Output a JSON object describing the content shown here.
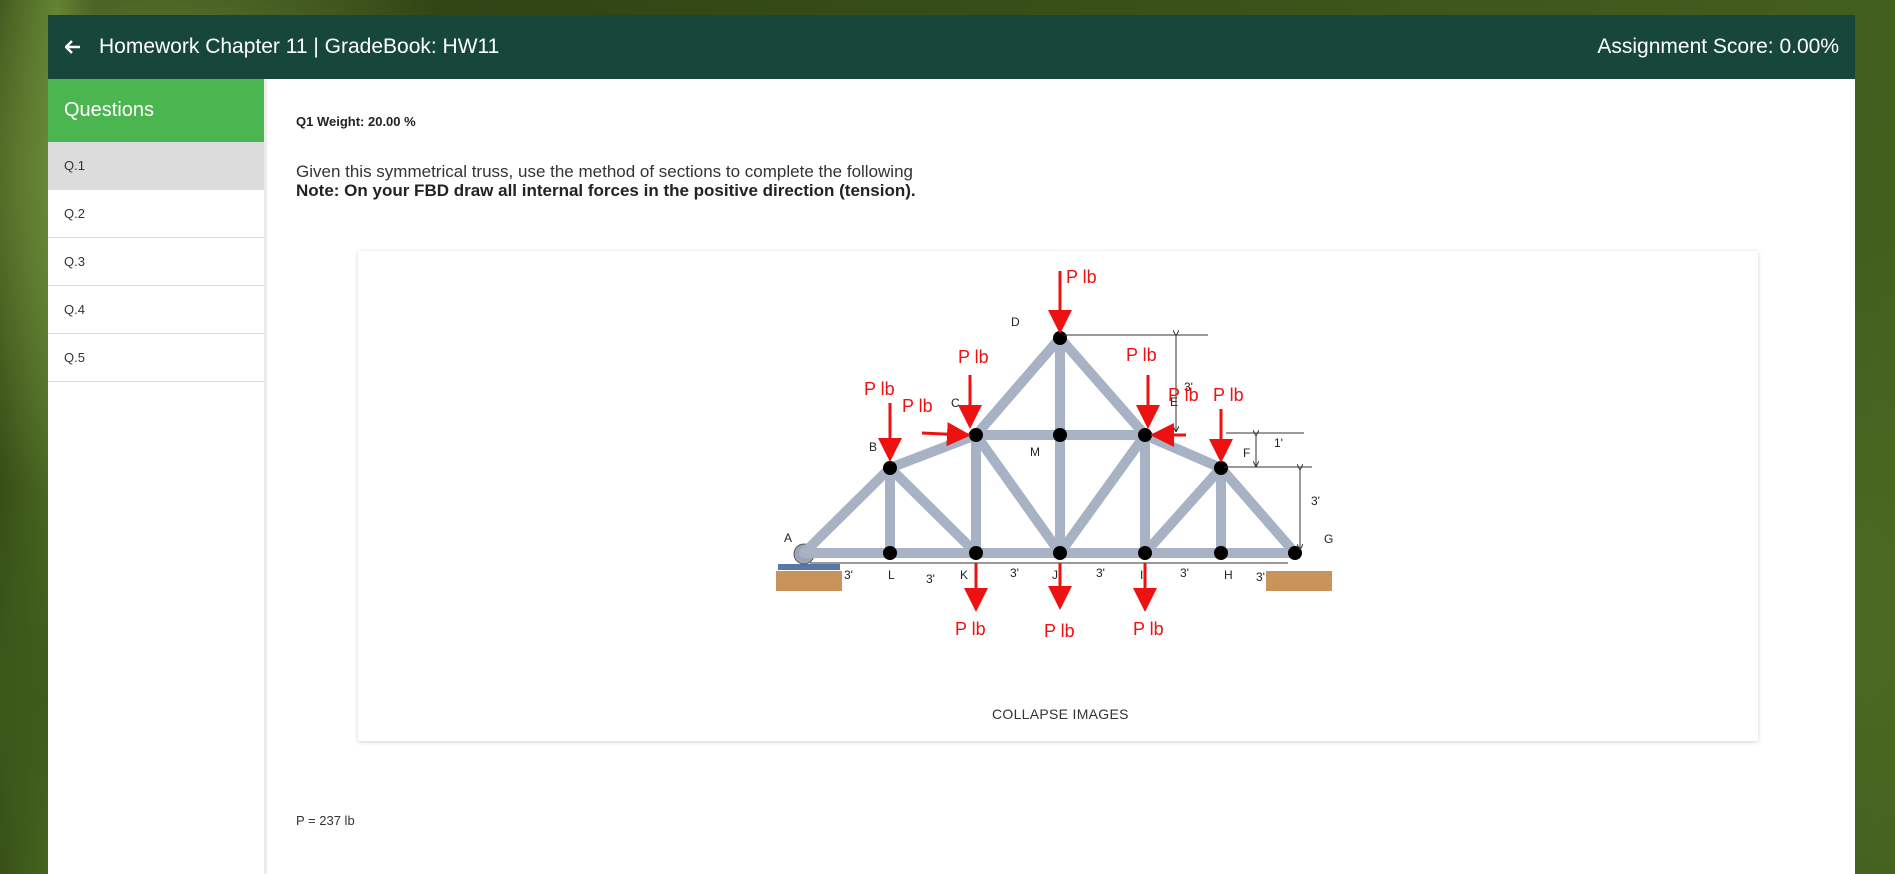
{
  "header": {
    "back_icon": "arrow-left-icon",
    "title": "Homework Chapter 11 | GradeBook: HW11",
    "score": "Assignment Score: 0.00%"
  },
  "sidebar": {
    "heading": "Questions",
    "items": [
      {
        "label": "Q.1",
        "active": true
      },
      {
        "label": "Q.2",
        "active": false
      },
      {
        "label": "Q.3",
        "active": false
      },
      {
        "label": "Q.4",
        "active": false
      },
      {
        "label": "Q.5",
        "active": false
      }
    ]
  },
  "question": {
    "weight": "Q1 Weight: 20.00 %",
    "text": "Given this symmetrical truss, use the method of sections to complete the following",
    "note": "Note: On your FBD draw all internal forces in the positive direction (tension).",
    "collapse_label": "COLLAPSE IMAGES",
    "p_value": "P = 237 lb"
  },
  "figure": {
    "load_label": "P lb",
    "joints": [
      "A",
      "B",
      "C",
      "D",
      "E",
      "F",
      "G",
      "L",
      "K",
      "J",
      "I",
      "H",
      "M"
    ],
    "dimensions": [
      "3'",
      "3'",
      "3'",
      "3'",
      "3'",
      "3'",
      "3'",
      "1'",
      "3'"
    ],
    "colors": {
      "member": "#a7b2c4",
      "load": "#ee1111",
      "joint": "#000000"
    }
  }
}
